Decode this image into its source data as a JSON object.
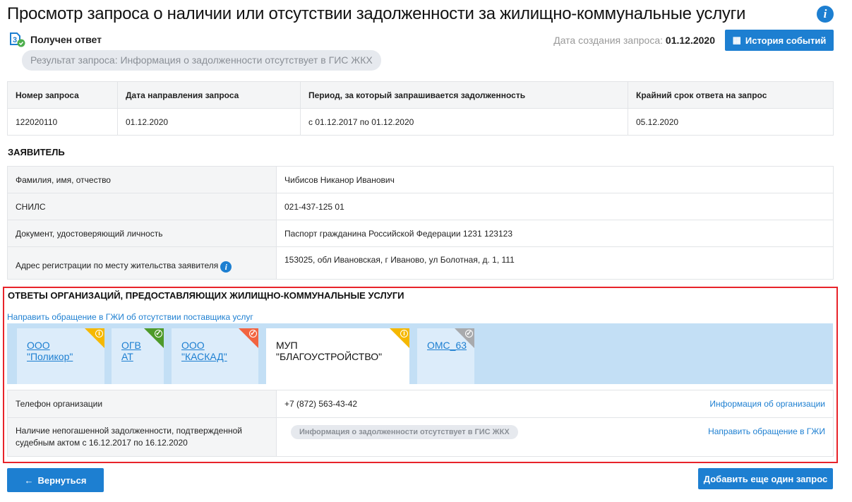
{
  "title": "Просмотр запроса о наличии или отсутствии задолженности за жилищно-коммунальные услуги",
  "status": "Получен ответ",
  "result": "Результат запроса: Информация о задолженности отсутствует в ГИС ЖКХ",
  "created_label": "Дата создания запроса:",
  "created_value": "01.12.2020",
  "history_button": "История событий",
  "request_table": {
    "headers": [
      "Номер запроса",
      "Дата направления запроса",
      "Период, за который запрашивается задолженность",
      "Крайний срок ответа на запрос"
    ],
    "row": [
      "122020110",
      "01.12.2020",
      "с 01.12.2017 по 01.12.2020",
      "05.12.2020"
    ]
  },
  "applicant": {
    "title": "ЗАЯВИТЕЛЬ",
    "rows": [
      [
        "Фамилия, имя, отчество",
        "Чибисов Никанор Иванович"
      ],
      [
        "СНИЛС",
        "021-437-125 01"
      ],
      [
        "Документ, удостоверяющий личность",
        "Паспорт гражданина Российской Федерации 1231 123123"
      ],
      [
        "Адрес регистрации по месту жительства заявителя",
        "153025, обл Ивановская, г Иваново, ул Болотная, д. 1, 111"
      ]
    ]
  },
  "orgs": {
    "title": "ОТВЕТЫ ОРГАНИЗАЦИЙ, ПРЕДОСТАВЛЯЮЩИХ ЖИЛИЩНО-КОММУНАЛЬНЫЕ УСЛУГИ",
    "gji_link": "Направить обращение в ГЖИ об отсутствии поставщика услуг",
    "tabs": [
      {
        "label": "ООО \"Поликор\"",
        "color": "#f5b800",
        "icon": "info"
      },
      {
        "label": "ОГВ АТ",
        "color": "#4e9a2a",
        "icon": "check"
      },
      {
        "label": "ООО \"КАСКАД\"",
        "color": "#f26440",
        "icon": "check"
      },
      {
        "label": "МУП \"БЛАГОУСТРОЙСТВО\"",
        "color": "#f5b800",
        "icon": "info"
      },
      {
        "label": "ОМС_63",
        "color": "#a8aaad",
        "icon": "check"
      }
    ],
    "phone_label": "Телефон организации",
    "phone": "+7 (872) 563-43-42",
    "org_info_link": "Информация об организации",
    "debt_label": "Наличие непогашенной задолженности, подтвержденной судебным актом с 16.12.2017 по 16.12.2020",
    "debt_value": "Информация о задолженности отсутствует в ГИС ЖКХ",
    "gji_link2": "Направить обращение в ГЖИ"
  },
  "back_button": "Вернуться",
  "add_button": "Добавить еще один запрос"
}
